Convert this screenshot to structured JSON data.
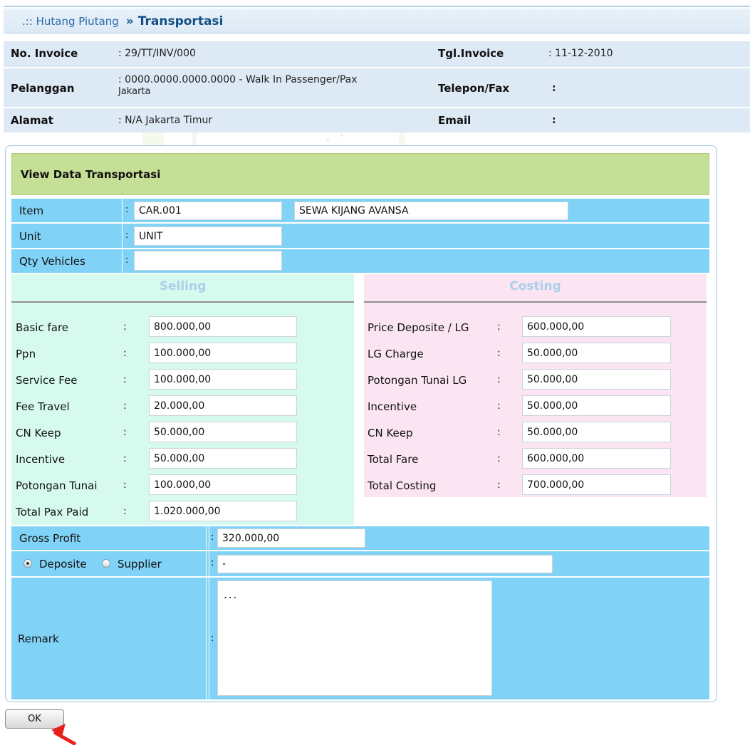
{
  "breadcrumb": {
    "prefix": ".:: Hutang Piutang",
    "separator": "»",
    "current": "Transportasi"
  },
  "invoice_info": {
    "no_invoice_label": "No. Invoice",
    "no_invoice_value": ": 29/TT/INV/000",
    "tgl_invoice_label": "Tgl.Invoice",
    "tgl_invoice_value": ": 11-12-2010",
    "pelanggan_label": "Pelanggan",
    "pelanggan_value_line1": ": 0000.0000.0000.0000 - Walk In Passenger/Pax",
    "pelanggan_value_line2": "Jakarta",
    "telepon_label": "Telepon/Fax",
    "telepon_value": ":",
    "alamat_label": "Alamat",
    "alamat_value": ": N/A Jakarta Timur",
    "email_label": "Email",
    "email_value": ":"
  },
  "panel_title": "View Data Transportasi",
  "item_rows": {
    "item_label": "Item",
    "item_code": "CAR.001",
    "item_name": "SEWA KIJANG AVANSA",
    "unit_label": "Unit",
    "unit_value": "UNIT",
    "qty_label": "Qty Vehicles",
    "qty_value": ""
  },
  "colon": ":",
  "selling": {
    "title": "Selling",
    "fields": [
      {
        "label": "Basic fare",
        "value": "800.000,00"
      },
      {
        "label": "Ppn",
        "value": "100.000,00"
      },
      {
        "label": "Service Fee",
        "value": "100.000,00"
      },
      {
        "label": "Fee Travel",
        "value": "20.000,00"
      },
      {
        "label": "CN Keep",
        "value": "50.000,00"
      },
      {
        "label": "Incentive",
        "value": "50.000,00"
      },
      {
        "label": "Potongan Tunai",
        "value": "100.000,00"
      },
      {
        "label": "Total Pax Paid",
        "value": "1.020.000,00"
      }
    ]
  },
  "costing": {
    "title": "Costing",
    "fields": [
      {
        "label": "Price Deposite / LG",
        "value": "600.000,00"
      },
      {
        "label": "LG Charge",
        "value": "50.000,00"
      },
      {
        "label": "Potongan Tunai LG",
        "value": "50.000,00"
      },
      {
        "label": "Incentive",
        "value": "50.000,00"
      },
      {
        "label": "CN Keep",
        "value": "50.000,00"
      },
      {
        "label": "Total Fare",
        "value": "600.000,00"
      },
      {
        "label": "Total Costing",
        "value": "700.000,00"
      }
    ]
  },
  "gross_profit": {
    "label": "Gross Profit",
    "value": "320.000,00"
  },
  "source": {
    "option_deposite": "Deposite",
    "option_supplier": "Supplier",
    "selected": "Deposite",
    "value": "-"
  },
  "remark": {
    "label": "Remark",
    "value": "..."
  },
  "ok_button": "OK",
  "colors": {
    "header_bg": "#dde9f5",
    "panel_title_bg": "#c6df97",
    "row_bg": "#80d3f6",
    "selling_bg": "#d6fbee",
    "costing_bg": "#fbe5f2",
    "section_title": "#a9cfe9",
    "arrow": "#e8201c"
  }
}
